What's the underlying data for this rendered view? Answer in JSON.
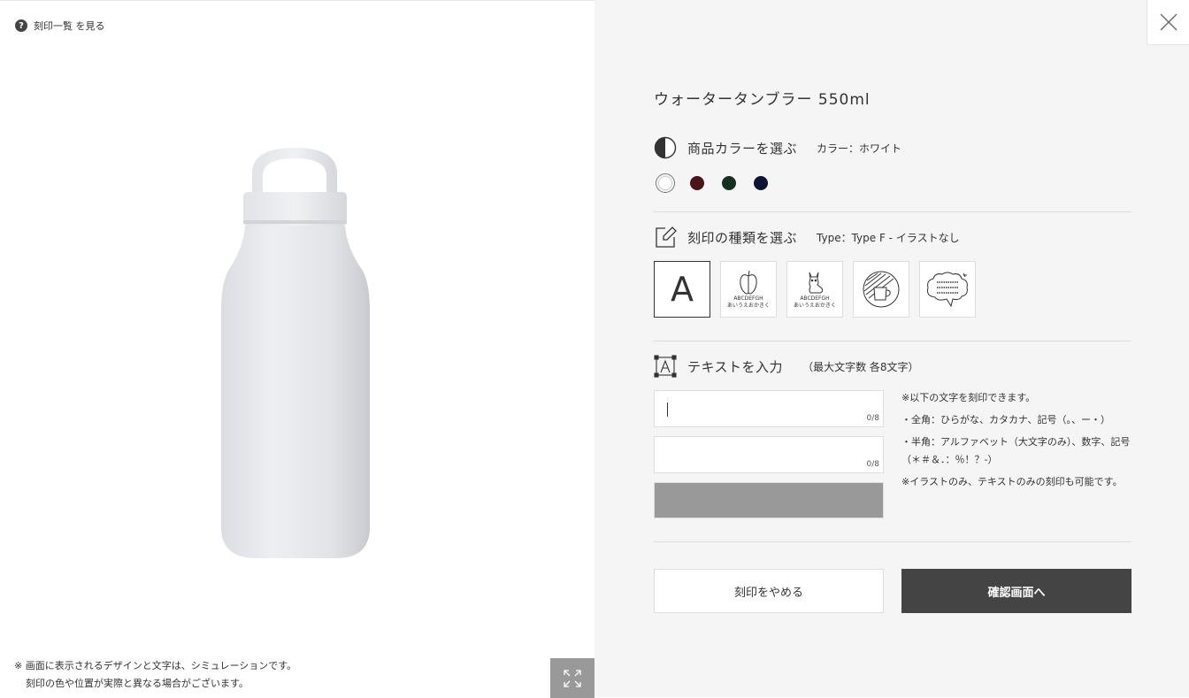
{
  "preview": {
    "help_link": "刻印一覧 を見る",
    "help_icon": "?",
    "disclaimer_line1": "※ 画面に表示されるデザインと文字は、シミュレーションです。",
    "disclaimer_line2": "刻印の色や位置が実際と異なる場合がございます。"
  },
  "product": {
    "title": "ウォータータンブラー 550ml"
  },
  "color_section": {
    "label": "商品カラーを選ぶ",
    "current": "カラー：ホワイト",
    "swatches": [
      {
        "name": "white",
        "color": "#ffffff",
        "selected": true
      },
      {
        "name": "dark-red",
        "color": "#4a1418"
      },
      {
        "name": "dark-green",
        "color": "#16301f"
      },
      {
        "name": "navy",
        "color": "#0e1534"
      }
    ]
  },
  "type_section": {
    "label": "刻印の種類を選ぶ",
    "current": "Type：Type F - イラストなし",
    "types": [
      {
        "name": "text-only",
        "glyph": "A",
        "selected": true
      },
      {
        "name": "apple",
        "caption1": "ABCDEFGH",
        "caption2": "あいうえおかきく"
      },
      {
        "name": "dog",
        "caption1": "ABCDEFGH",
        "caption2": "あいうえおかきく"
      },
      {
        "name": "mug",
        "caption1": "ABCDEFGH"
      },
      {
        "name": "cloud",
        "caption1": "ABCDEFGH",
        "caption2": "ABCDEFGH",
        "caption3": "ABCDEFGH"
      }
    ]
  },
  "text_section": {
    "label": "テキストを入力",
    "limit": "（最大文字数 各8文字）",
    "line1": {
      "value": "",
      "count": "0/8"
    },
    "line2": {
      "value": "",
      "count": "0/8"
    },
    "notes": [
      "※以下の文字を刻印できます。",
      "・全角：ひらがな、カタカナ、記号（。、ー・）",
      "・半角：アルファベット（大文字のみ）、数字、記号（＊＃＆．：％！？-）",
      "※イラストのみ、テキストのみの刻印も可能です。"
    ]
  },
  "actions": {
    "cancel": "刻印をやめる",
    "confirm": "確認画面へ"
  },
  "colors": {
    "panel_bg": "#f4f5f4",
    "confirm_bg": "#444444",
    "graybar": "#999999"
  }
}
